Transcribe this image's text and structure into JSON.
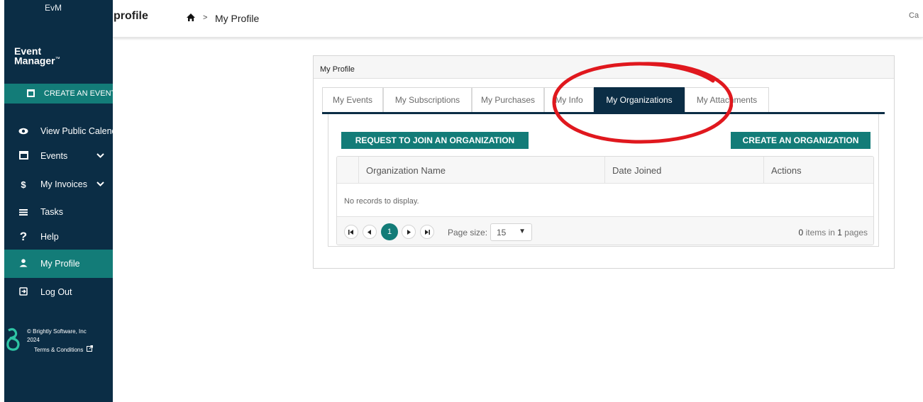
{
  "sidebar": {
    "app_short": "EvM",
    "logo_line1": "Event",
    "logo_line2": "Manager",
    "logo_tm": "™",
    "create_button": "CREATE AN EVENT",
    "items": [
      {
        "label": "View Public Calendar",
        "icon": "eye-icon"
      },
      {
        "label": "Events",
        "icon": "calendar-icon"
      },
      {
        "label": "My Invoices",
        "icon": "dollar-icon"
      },
      {
        "label": "Tasks",
        "icon": "list-icon"
      },
      {
        "label": "Help",
        "icon": "question-icon"
      },
      {
        "label": "My Profile",
        "icon": "user-icon"
      },
      {
        "label": "Log Out",
        "icon": "logout-icon"
      }
    ],
    "footer": {
      "copyright": "© Brightly Software, Inc",
      "year": "2024",
      "terms": "Terms & Conditions"
    }
  },
  "header": {
    "title": "profile",
    "breadcrumb_current": "My Profile",
    "breadcrumb_sep": ">",
    "right_cut_text": "Ca"
  },
  "panel": {
    "title": "My Profile",
    "tabs": [
      {
        "label": "My Events",
        "active": false
      },
      {
        "label": "My Subscriptions",
        "active": false
      },
      {
        "label": "My Purchases",
        "active": false
      },
      {
        "label": "My Info",
        "active": false
      },
      {
        "label": "My Organizations",
        "active": true
      },
      {
        "label": "My Attachments",
        "active": false
      }
    ],
    "request_button": "REQUEST TO JOIN AN ORGANIZATION",
    "create_button": "CREATE AN ORGANIZATION",
    "grid": {
      "columns": [
        "Organization Name",
        "Date Joined",
        "Actions"
      ],
      "empty_text": "No records to display.",
      "pager": {
        "current_page": "1",
        "page_size_label": "Page size:",
        "page_size": "15",
        "items_count": "0",
        "items_text": "items in",
        "pages_count": "1",
        "pages_text": "pages"
      }
    }
  },
  "colors": {
    "sidebar_bg": "#0b2d45",
    "accent_teal": "#137c78",
    "annotation_red": "#e0181e"
  }
}
